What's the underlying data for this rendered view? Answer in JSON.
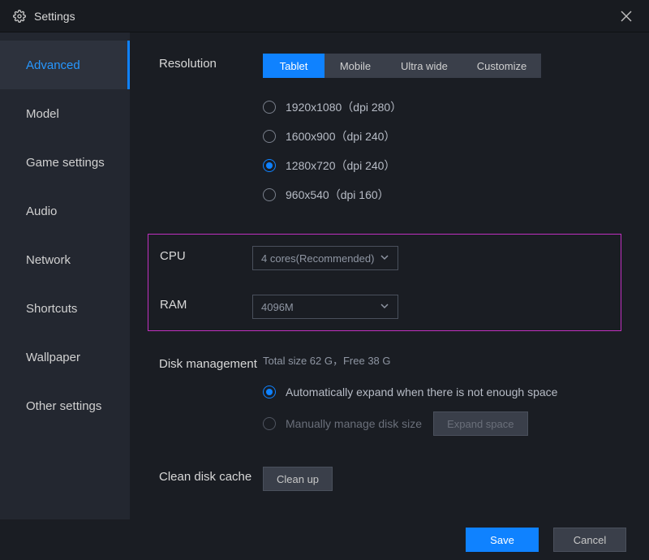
{
  "window": {
    "title": "Settings"
  },
  "sidebar": {
    "items": [
      {
        "label": "Advanced",
        "active": true
      },
      {
        "label": "Model",
        "active": false
      },
      {
        "label": "Game settings",
        "active": false
      },
      {
        "label": "Audio",
        "active": false
      },
      {
        "label": "Network",
        "active": false
      },
      {
        "label": "Shortcuts",
        "active": false
      },
      {
        "label": "Wallpaper",
        "active": false
      },
      {
        "label": "Other settings",
        "active": false
      }
    ]
  },
  "resolution": {
    "label": "Resolution",
    "tabs": [
      {
        "label": "Tablet",
        "active": true
      },
      {
        "label": "Mobile",
        "active": false
      },
      {
        "label": "Ultra wide",
        "active": false
      },
      {
        "label": "Customize",
        "active": false
      }
    ],
    "options": [
      {
        "label": "1920x1080（dpi 280）",
        "selected": false
      },
      {
        "label": "1600x900（dpi 240）",
        "selected": false
      },
      {
        "label": "1280x720（dpi 240）",
        "selected": true
      },
      {
        "label": "960x540（dpi 160）",
        "selected": false
      }
    ]
  },
  "cpu": {
    "label": "CPU",
    "value": "4 cores(Recommended)"
  },
  "ram": {
    "label": "RAM",
    "value": "4096M"
  },
  "disk": {
    "label": "Disk management",
    "status": "Total size 62 G，Free 38 G",
    "options": {
      "auto": {
        "label": "Automatically expand when there is not enough space",
        "selected": true
      },
      "manual": {
        "label": "Manually manage disk size",
        "selected": false
      }
    },
    "expand_button": "Expand space"
  },
  "clean": {
    "label": "Clean disk cache",
    "button": "Clean up"
  },
  "footer": {
    "save": "Save",
    "cancel": "Cancel"
  }
}
